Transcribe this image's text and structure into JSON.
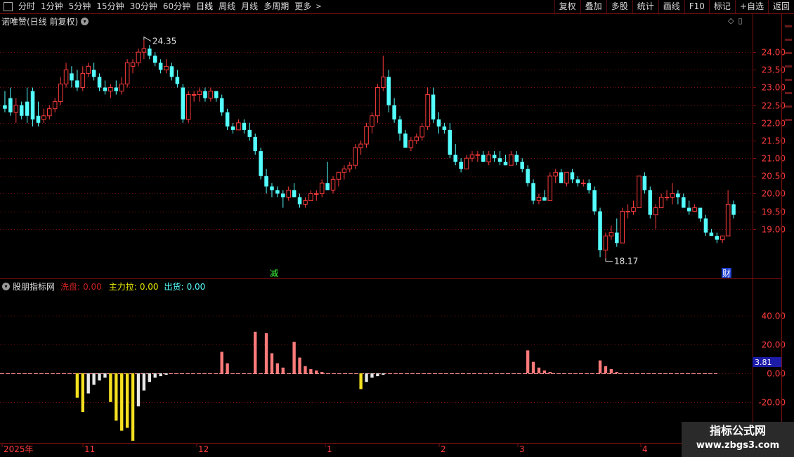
{
  "toolbar": {
    "left_items": [
      "分时",
      "1分钟",
      "5分钟",
      "15分钟",
      "30分钟",
      "60分钟",
      "日线",
      "周线",
      "月线",
      "多周期",
      "更多"
    ],
    "active": "日线",
    "right_items": [
      "复权",
      "叠加",
      "多股",
      "统计",
      "画线",
      "F10",
      "标记",
      "+自选",
      "返回"
    ]
  },
  "main_title": "诺唯赞(日线 前复权)",
  "sub_panel": {
    "title": "股朋指标网",
    "indicators": [
      {
        "label": "洗盘:",
        "value": "0.00",
        "color": "#cc2222"
      },
      {
        "label": "主力拉:",
        "value": "0.00",
        "color": "#e8e800"
      },
      {
        "label": "出货:",
        "value": "0.00",
        "color": "#55ffff"
      }
    ],
    "current_value_tag": "3.81"
  },
  "markers": {
    "high_label": "24.35",
    "low_label": "18.17",
    "event1": "减",
    "event2": "财"
  },
  "x_axis_labels": [
    "2025年",
    "11",
    "12",
    "1",
    "2",
    "3",
    "4"
  ],
  "watermark": {
    "line1": "指标公式网",
    "line2": "www.zbgs3.com"
  },
  "colors": {
    "up": "#ff3c3c",
    "down": "#54ffff",
    "grid": "#7a1010",
    "axis_text": "#ff3c3c",
    "yellow": "#f5e020",
    "white": "#e8e8e8",
    "pink": "#ff7a7a"
  },
  "chart_data": [
    {
      "type": "candlestick",
      "title": "诺唯赞(日线 前复权)",
      "ylim": [
        18.0,
        24.6
      ],
      "y_ticks": [
        19.0,
        19.5,
        20.0,
        20.5,
        21.0,
        21.5,
        22.0,
        22.5,
        23.0,
        23.5,
        24.0
      ],
      "annotations": {
        "max": 24.35,
        "min": 18.17
      },
      "ohlc": [
        [
          22.5,
          22.9,
          22.3,
          22.4
        ],
        [
          22.7,
          23.0,
          22.2,
          22.3
        ],
        [
          22.3,
          22.7,
          22.0,
          22.5
        ],
        [
          22.5,
          22.6,
          22.1,
          22.2
        ],
        [
          22.6,
          23.0,
          22.0,
          22.2
        ],
        [
          22.9,
          23.0,
          21.9,
          22.1
        ],
        [
          22.2,
          22.6,
          21.9,
          22.0
        ],
        [
          22.1,
          22.4,
          22.0,
          22.2
        ],
        [
          22.2,
          22.5,
          22.1,
          22.4
        ],
        [
          22.4,
          22.7,
          22.3,
          22.6
        ],
        [
          22.6,
          23.3,
          22.5,
          23.1
        ],
        [
          23.1,
          23.7,
          23.0,
          23.5
        ],
        [
          23.4,
          23.6,
          23.0,
          23.2
        ],
        [
          23.2,
          23.5,
          22.9,
          23.0
        ],
        [
          23.0,
          23.6,
          22.9,
          23.4
        ],
        [
          23.4,
          23.7,
          23.3,
          23.6
        ],
        [
          23.5,
          23.7,
          23.2,
          23.3
        ],
        [
          23.3,
          23.4,
          22.9,
          23.0
        ],
        [
          23.0,
          23.2,
          22.8,
          22.9
        ],
        [
          22.9,
          23.1,
          22.7,
          23.0
        ],
        [
          23.0,
          23.2,
          22.8,
          22.9
        ],
        [
          22.9,
          23.3,
          22.8,
          23.1
        ],
        [
          23.1,
          23.8,
          23.0,
          23.7
        ],
        [
          23.6,
          23.8,
          23.4,
          23.7
        ],
        [
          23.7,
          24.1,
          23.6,
          24.0
        ],
        [
          24.0,
          24.35,
          23.8,
          24.1
        ],
        [
          24.1,
          24.2,
          23.8,
          23.9
        ],
        [
          23.9,
          24.0,
          23.6,
          23.7
        ],
        [
          23.7,
          23.8,
          23.4,
          23.5
        ],
        [
          23.5,
          23.8,
          23.4,
          23.6
        ],
        [
          23.6,
          23.7,
          23.2,
          23.3
        ],
        [
          23.3,
          23.5,
          23.0,
          23.1
        ],
        [
          23.0,
          23.1,
          22.0,
          22.1
        ],
        [
          22.1,
          22.9,
          22.0,
          22.8
        ],
        [
          22.8,
          22.9,
          22.6,
          22.8
        ],
        [
          22.8,
          23.0,
          22.6,
          22.9
        ],
        [
          22.9,
          23.0,
          22.6,
          22.7
        ],
        [
          22.7,
          23.0,
          22.6,
          22.9
        ],
        [
          22.9,
          22.9,
          22.6,
          22.7
        ],
        [
          22.7,
          22.8,
          22.2,
          22.3
        ],
        [
          22.3,
          22.4,
          21.8,
          21.9
        ],
        [
          21.9,
          22.0,
          21.7,
          21.8
        ],
        [
          21.8,
          22.1,
          21.8,
          22.0
        ],
        [
          22.0,
          22.1,
          21.7,
          21.8
        ],
        [
          21.8,
          22.0,
          21.5,
          21.6
        ],
        [
          21.6,
          21.7,
          21.1,
          21.2
        ],
        [
          21.2,
          21.3,
          20.4,
          20.5
        ],
        [
          20.5,
          20.7,
          20.0,
          20.2
        ],
        [
          20.2,
          20.3,
          19.9,
          20.1
        ],
        [
          20.1,
          20.2,
          19.9,
          20.0
        ],
        [
          20.0,
          20.1,
          19.6,
          19.9
        ],
        [
          19.9,
          20.2,
          19.8,
          20.1
        ],
        [
          20.1,
          20.3,
          19.9,
          19.9
        ],
        [
          19.9,
          20.0,
          19.6,
          19.7
        ],
        [
          19.7,
          19.9,
          19.6,
          19.8
        ],
        [
          19.8,
          20.1,
          19.8,
          20.0
        ],
        [
          20.0,
          20.1,
          19.8,
          20.0
        ],
        [
          20.0,
          20.4,
          19.9,
          20.3
        ],
        [
          20.3,
          20.9,
          20.2,
          20.1
        ],
        [
          20.1,
          20.5,
          20.0,
          20.4
        ],
        [
          20.4,
          20.6,
          20.2,
          20.6
        ],
        [
          20.6,
          20.8,
          20.4,
          20.7
        ],
        [
          20.7,
          20.9,
          20.6,
          20.8
        ],
        [
          20.8,
          21.4,
          20.7,
          21.3
        ],
        [
          21.3,
          21.5,
          21.1,
          21.4
        ],
        [
          21.4,
          22.0,
          21.3,
          21.9
        ],
        [
          21.9,
          22.3,
          21.7,
          22.2
        ],
        [
          22.2,
          23.1,
          22.0,
          23.0
        ],
        [
          23.0,
          23.9,
          22.9,
          23.3
        ],
        [
          23.3,
          23.5,
          22.3,
          22.5
        ],
        [
          22.5,
          22.7,
          22.0,
          22.1
        ],
        [
          22.1,
          22.2,
          21.5,
          21.7
        ],
        [
          21.7,
          21.8,
          21.3,
          21.3
        ],
        [
          21.3,
          21.6,
          21.2,
          21.5
        ],
        [
          21.5,
          21.7,
          21.4,
          21.6
        ],
        [
          21.6,
          22.0,
          21.5,
          21.9
        ],
        [
          21.9,
          23.0,
          21.8,
          22.8
        ],
        [
          22.8,
          23.0,
          22.0,
          22.1
        ],
        [
          22.1,
          22.3,
          21.7,
          21.9
        ],
        [
          21.9,
          22.0,
          21.7,
          21.8
        ],
        [
          21.8,
          22.0,
          21.0,
          21.1
        ],
        [
          21.1,
          21.4,
          20.8,
          20.9
        ],
        [
          20.9,
          21.0,
          20.6,
          20.7
        ],
        [
          20.7,
          21.1,
          20.7,
          21.0
        ],
        [
          21.0,
          21.2,
          20.9,
          21.1
        ],
        [
          21.1,
          21.2,
          20.9,
          21.1
        ],
        [
          21.1,
          21.2,
          20.9,
          20.9
        ],
        [
          20.9,
          21.2,
          20.8,
          21.1
        ],
        [
          21.1,
          21.2,
          20.9,
          21.0
        ],
        [
          21.0,
          21.2,
          20.8,
          20.9
        ],
        [
          20.9,
          21.1,
          20.8,
          20.8
        ],
        [
          20.8,
          21.2,
          20.8,
          21.1
        ],
        [
          21.1,
          21.2,
          20.8,
          20.9
        ],
        [
          20.9,
          21.0,
          20.6,
          20.7
        ],
        [
          20.7,
          20.8,
          20.2,
          20.3
        ],
        [
          20.3,
          20.4,
          19.7,
          19.8
        ],
        [
          19.8,
          20.0,
          19.7,
          19.9
        ],
        [
          19.9,
          20.1,
          19.8,
          19.8
        ],
        [
          19.8,
          20.6,
          19.8,
          20.5
        ],
        [
          20.5,
          20.7,
          20.3,
          20.6
        ],
        [
          20.6,
          20.7,
          20.3,
          20.3
        ],
        [
          20.3,
          20.6,
          20.2,
          20.6
        ],
        [
          20.6,
          20.7,
          20.3,
          20.4
        ],
        [
          20.4,
          20.5,
          20.2,
          20.3
        ],
        [
          20.3,
          20.4,
          20.2,
          20.3
        ],
        [
          20.3,
          20.4,
          20.0,
          20.1
        ],
        [
          20.1,
          20.2,
          19.4,
          19.5
        ],
        [
          19.5,
          19.6,
          18.2,
          18.4
        ],
        [
          18.4,
          18.9,
          18.17,
          18.8
        ],
        [
          18.8,
          19.1,
          18.7,
          18.9
        ],
        [
          18.9,
          19.3,
          18.5,
          18.6
        ],
        [
          18.6,
          19.6,
          18.6,
          19.5
        ],
        [
          19.5,
          19.7,
          19.3,
          19.5
        ],
        [
          19.5,
          19.8,
          19.4,
          19.6
        ],
        [
          19.6,
          20.5,
          19.6,
          20.5
        ],
        [
          20.5,
          20.6,
          20.0,
          20.1
        ],
        [
          20.1,
          20.2,
          19.3,
          19.4
        ],
        [
          19.4,
          19.7,
          19.0,
          19.6
        ],
        [
          19.6,
          20.0,
          19.6,
          19.9
        ],
        [
          19.9,
          20.1,
          19.8,
          19.9
        ],
        [
          19.9,
          20.3,
          19.7,
          20.0
        ],
        [
          20.0,
          20.1,
          19.7,
          19.9
        ],
        [
          19.9,
          20.0,
          19.6,
          19.6
        ],
        [
          19.6,
          19.8,
          19.4,
          19.5
        ],
        [
          19.5,
          19.7,
          19.5,
          19.6
        ],
        [
          19.6,
          19.6,
          19.2,
          19.3
        ],
        [
          19.3,
          19.4,
          18.8,
          18.9
        ],
        [
          18.9,
          19.0,
          18.8,
          18.8
        ],
        [
          18.8,
          18.9,
          18.6,
          18.7
        ],
        [
          18.7,
          18.8,
          18.6,
          18.8
        ],
        [
          18.8,
          20.1,
          18.8,
          19.7
        ],
        [
          19.7,
          19.8,
          19.3,
          19.4
        ]
      ]
    },
    {
      "type": "bar",
      "title": "股朋指标网",
      "ylim": [
        -25,
        60
      ],
      "y_ticks": [
        -20.0,
        0.0,
        20.0,
        40.0
      ],
      "series": [
        {
          "name": "洗盘",
          "color": "yellow",
          "values": [
            {
              "i": 13,
              "v": -17
            },
            {
              "i": 14,
              "v": -27
            },
            {
              "i": 19,
              "v": -20
            },
            {
              "i": 20,
              "v": -33
            },
            {
              "i": 21,
              "v": -40
            },
            {
              "i": 22,
              "v": -38
            },
            {
              "i": 23,
              "v": -47
            },
            {
              "i": 64,
              "v": -11
            }
          ]
        },
        {
          "name": "白柱",
          "color": "white",
          "values": [
            {
              "i": 15,
              "v": -14
            },
            {
              "i": 16,
              "v": -8
            },
            {
              "i": 17,
              "v": -5
            },
            {
              "i": 18,
              "v": -3
            },
            {
              "i": 24,
              "v": -23
            },
            {
              "i": 25,
              "v": -12
            },
            {
              "i": 26,
              "v": -6
            },
            {
              "i": 27,
              "v": -3
            },
            {
              "i": 28,
              "v": -2
            },
            {
              "i": 29,
              "v": -1
            },
            {
              "i": 65,
              "v": -6
            },
            {
              "i": 66,
              "v": -3
            },
            {
              "i": 67,
              "v": -2
            },
            {
              "i": 68,
              "v": -1
            }
          ]
        },
        {
          "name": "主力拉",
          "color": "pink",
          "values": [
            {
              "i": 39,
              "v": 15
            },
            {
              "i": 40,
              "v": 7
            },
            {
              "i": 45,
              "v": 29
            },
            {
              "i": 47,
              "v": 28
            },
            {
              "i": 48,
              "v": 14
            },
            {
              "i": 49,
              "v": 7
            },
            {
              "i": 50,
              "v": 4
            },
            {
              "i": 52,
              "v": 22
            },
            {
              "i": 53,
              "v": 11
            },
            {
              "i": 54,
              "v": 5
            },
            {
              "i": 55,
              "v": 3
            },
            {
              "i": 56,
              "v": 2
            },
            {
              "i": 57,
              "v": 1
            },
            {
              "i": 94,
              "v": 16
            },
            {
              "i": 95,
              "v": 8
            },
            {
              "i": 96,
              "v": 4
            },
            {
              "i": 97,
              "v": 2
            },
            {
              "i": 98,
              "v": 1
            },
            {
              "i": 107,
              "v": 9
            },
            {
              "i": 108,
              "v": 5
            },
            {
              "i": 109,
              "v": 3
            },
            {
              "i": 110,
              "v": 1
            }
          ]
        }
      ]
    }
  ]
}
